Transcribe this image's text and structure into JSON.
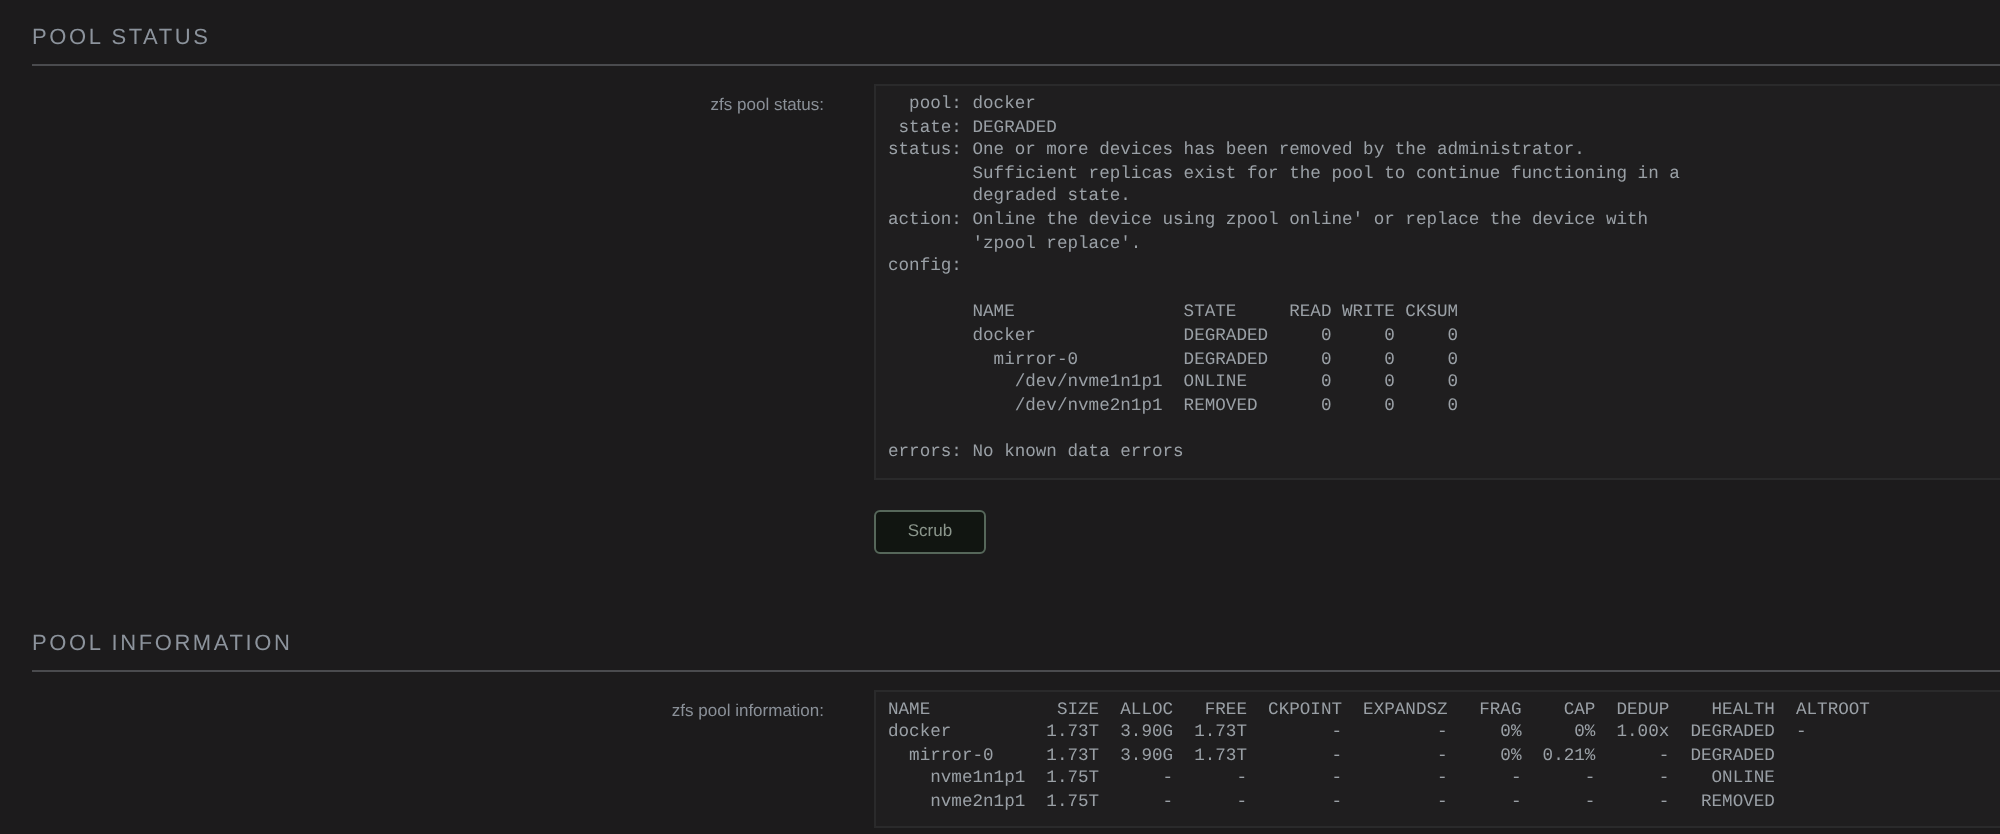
{
  "sections": [
    {
      "title": "POOL STATUS",
      "label": "zfs pool status:",
      "output_blocks": [
        [
          "  pool: docker",
          " state: DEGRADED",
          "status: One or more devices has been removed by the administrator.",
          "        Sufficient replicas exist for the pool to continue functioning in a",
          "        degraded state.",
          "action: Online the device using zpool online' or replace the device with",
          "        'zpool replace'.",
          "config:"
        ],
        [
          "        NAME                STATE     READ WRITE CKSUM",
          "        docker              DEGRADED     0     0     0",
          "          mirror-0          DEGRADED     0     0     0",
          "            /dev/nvme1n1p1  ONLINE       0     0     0",
          "            /dev/nvme2n1p1  REMOVED      0     0     0"
        ],
        [
          "errors: No known data errors"
        ]
      ],
      "buttons": [
        "Scrub"
      ]
    },
    {
      "title": "POOL INFORMATION",
      "label": "zfs pool information:",
      "output_blocks": [
        [
          "NAME            SIZE  ALLOC   FREE  CKPOINT  EXPANDSZ   FRAG    CAP  DEDUP    HEALTH  ALTROOT",
          "docker         1.73T  3.90G  1.73T        -         -     0%     0%  1.00x  DEGRADED  -",
          "  mirror-0     1.73T  3.90G  1.73T        -         -     0%  0.21%      -  DEGRADED",
          "    nvme1n1p1  1.75T      -      -        -         -      -      -      -    ONLINE",
          "    nvme2n1p1  1.75T      -      -        -         -      -      -      -   REMOVED"
        ]
      ]
    }
  ]
}
